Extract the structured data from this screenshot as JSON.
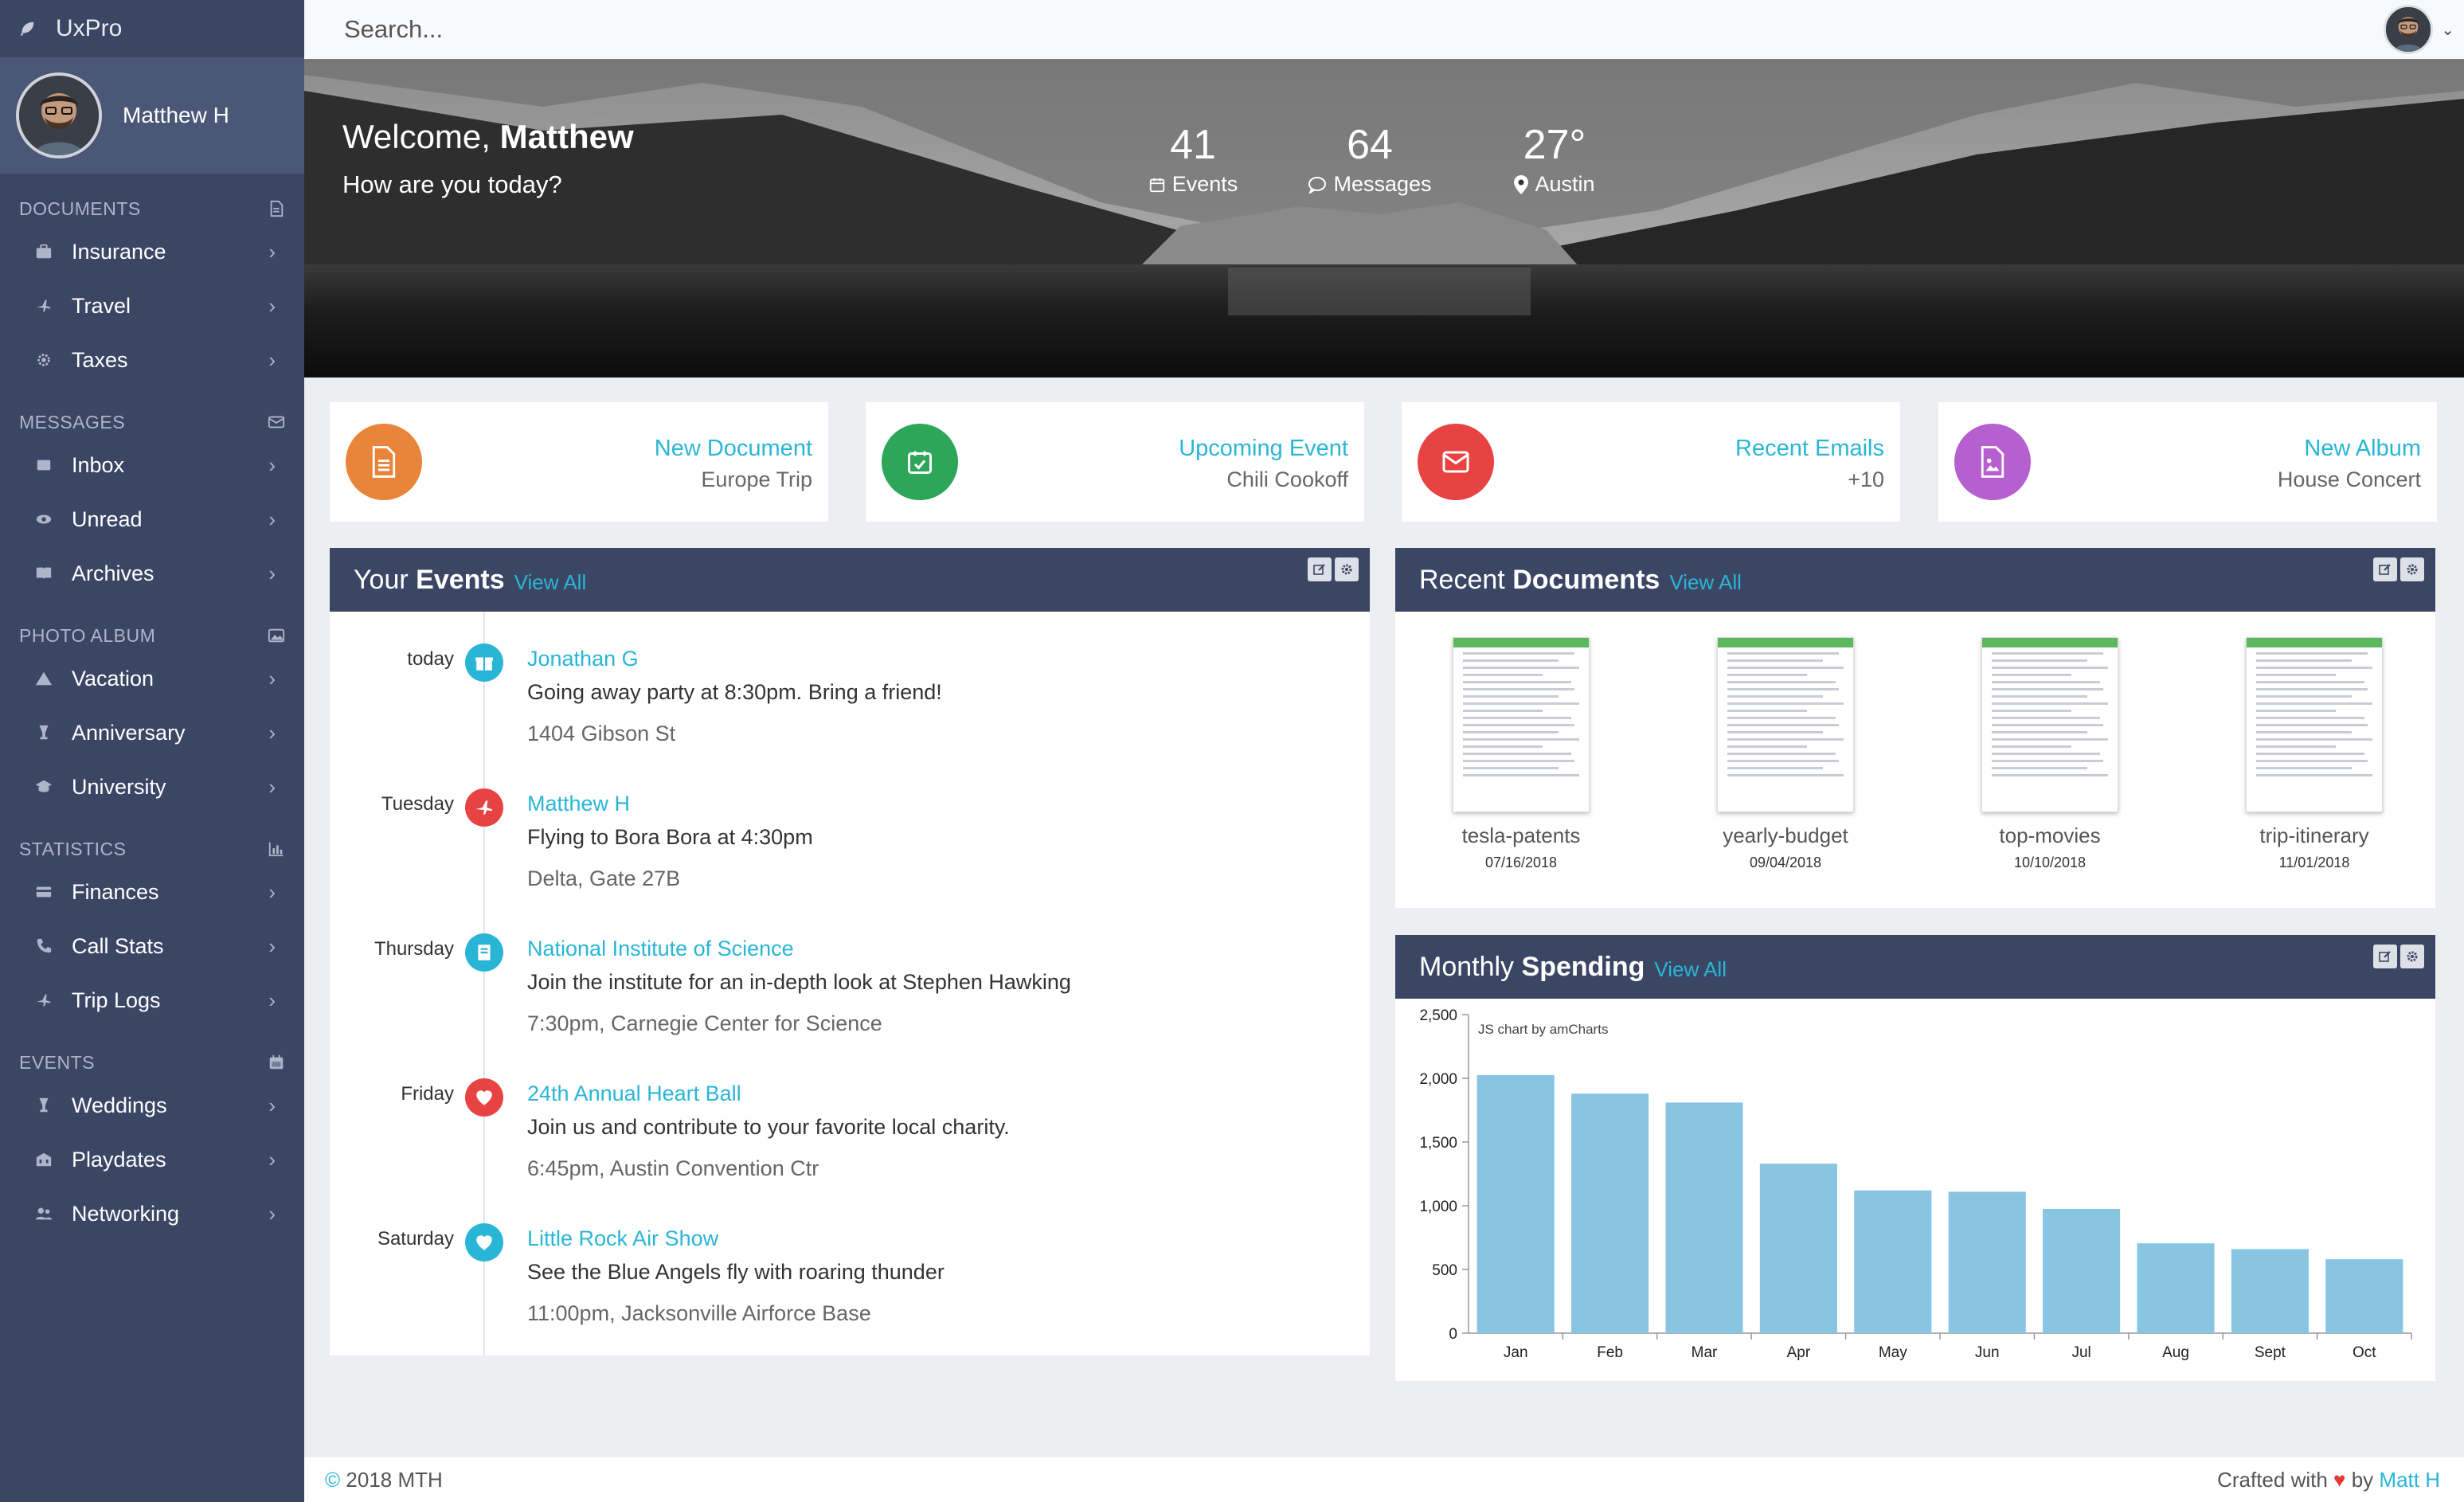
{
  "app": {
    "brand": "UxPro"
  },
  "user": {
    "name": "Matthew H"
  },
  "sidebar": {
    "sections": [
      {
        "title": "DOCUMENTS",
        "icon": "document-icon",
        "items": [
          {
            "label": "Insurance",
            "icon": "briefcase-icon"
          },
          {
            "label": "Travel",
            "icon": "plane-icon"
          },
          {
            "label": "Taxes",
            "icon": "gear-icon"
          }
        ]
      },
      {
        "title": "MESSAGES",
        "icon": "envelope-icon",
        "items": [
          {
            "label": "Inbox",
            "icon": "inbox-icon"
          },
          {
            "label": "Unread",
            "icon": "eye-icon"
          },
          {
            "label": "Archives",
            "icon": "book-icon"
          }
        ]
      },
      {
        "title": "PHOTO ALBUM",
        "icon": "image-icon",
        "items": [
          {
            "label": "Vacation",
            "icon": "mountain-icon"
          },
          {
            "label": "Anniversary",
            "icon": "glass-icon"
          },
          {
            "label": "University",
            "icon": "graduation-icon"
          }
        ]
      },
      {
        "title": "STATISTICS",
        "icon": "bar-chart-icon",
        "items": [
          {
            "label": "Finances",
            "icon": "credit-card-icon"
          },
          {
            "label": "Call Stats",
            "icon": "phone-icon"
          },
          {
            "label": "Trip Logs",
            "icon": "plane-icon"
          }
        ]
      },
      {
        "title": "EVENTS",
        "icon": "calendar-icon",
        "items": [
          {
            "label": "Weddings",
            "icon": "glass-icon"
          },
          {
            "label": "Playdates",
            "icon": "building-icon"
          },
          {
            "label": "Networking",
            "icon": "users-icon"
          }
        ]
      }
    ]
  },
  "search": {
    "placeholder": "Search..."
  },
  "hero": {
    "welcome": "Welcome,",
    "name": "Matthew",
    "subtitle": "How are you today?",
    "stats": [
      {
        "value": "41",
        "label": "Events",
        "icon": "calendar-icon"
      },
      {
        "value": "64",
        "label": "Messages",
        "icon": "comment-icon"
      },
      {
        "value": "27°",
        "label": "Austin",
        "icon": "map-marker-icon"
      }
    ]
  },
  "cards": [
    {
      "word1": "New",
      "word2": "Document",
      "sub": "Europe Trip",
      "color": "#e8853a",
      "icon": "file-icon"
    },
    {
      "word1": "Upcoming",
      "word2": "Event",
      "sub": "Chili Cookoff",
      "color": "#2ea65a",
      "icon": "calendar-check-icon"
    },
    {
      "word1": "Recent",
      "word2": "Emails",
      "sub": "+10",
      "color": "#e84343",
      "icon": "envelope-icon"
    },
    {
      "word1": "New",
      "word2": "Album",
      "sub": "House Concert",
      "color": "#b65fd0",
      "icon": "image-file-icon"
    }
  ],
  "events_panel": {
    "title_plain": "Your",
    "title_bold": "Events",
    "view_all": "View All",
    "events": [
      {
        "day": "today",
        "who": "Jonathan G",
        "what": "Going away party at 8:30pm. Bring a friend!",
        "where": "1404 Gibson St",
        "color": "#29b6d6",
        "icon": "gift-icon"
      },
      {
        "day": "Tuesday",
        "who": "Matthew H",
        "what": "Flying to Bora Bora at 4:30pm",
        "where": "Delta, Gate 27B",
        "color": "#e84343",
        "icon": "plane-icon"
      },
      {
        "day": "Thursday",
        "who": "National Institute of Science",
        "what": "Join the institute for an in-depth look at Stephen Hawking",
        "where": "7:30pm, Carnegie Center for Science",
        "color": "#29b6d6",
        "icon": "book-icon"
      },
      {
        "day": "Friday",
        "who": "24th Annual Heart Ball",
        "what": "Join us and contribute to your favorite local charity.",
        "where": "6:45pm, Austin Convention Ctr",
        "color": "#e84343",
        "icon": "heart-icon"
      },
      {
        "day": "Saturday",
        "who": "Little Rock Air Show",
        "what": "See the Blue Angels fly with roaring thunder",
        "where": "11:00pm, Jacksonville Airforce Base",
        "color": "#29b6d6",
        "icon": "heart-icon"
      }
    ]
  },
  "docs_panel": {
    "title_plain": "Recent",
    "title_bold": "Documents",
    "view_all": "View All",
    "docs": [
      {
        "name": "tesla-patents",
        "date": "07/16/2018"
      },
      {
        "name": "yearly-budget",
        "date": "09/04/2018"
      },
      {
        "name": "top-movies",
        "date": "10/10/2018"
      },
      {
        "name": "trip-itinerary",
        "date": "11/01/2018"
      }
    ]
  },
  "spending_panel": {
    "title_plain": "Monthly",
    "title_bold": "Spending",
    "view_all": "View All",
    "credit": "JS chart by amCharts"
  },
  "chart_data": {
    "type": "bar",
    "categories": [
      "Jan",
      "Feb",
      "Mar",
      "Apr",
      "May",
      "Jun",
      "Jul",
      "Aug",
      "Sept",
      "Oct"
    ],
    "values": [
      2025,
      1880,
      1810,
      1330,
      1120,
      1110,
      975,
      705,
      660,
      580
    ],
    "ylim": [
      0,
      2500
    ],
    "yticks": [
      "0",
      "500",
      "1,000",
      "1,500",
      "2,000",
      "2,500"
    ],
    "bar_color": "#87c5e3"
  },
  "footer": {
    "copy": "©",
    "year_owner": "2018 MTH",
    "crafted": "Crafted with",
    "by": "by",
    "author": "Matt H"
  }
}
